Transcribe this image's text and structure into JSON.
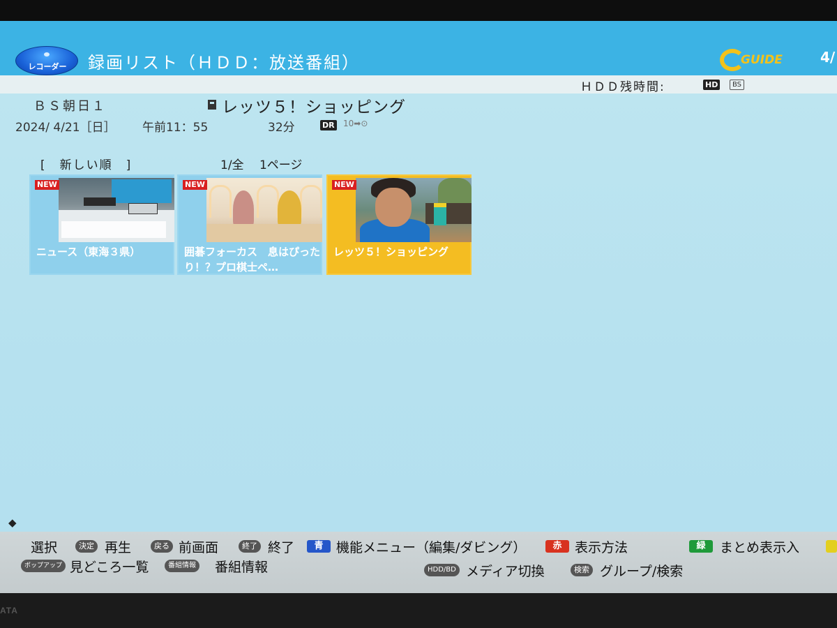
{
  "header": {
    "logo_label": "レコーダー",
    "title": "録画リスト（ＨＤＤ：放送番組）",
    "gguide_label": "GUIDE",
    "page_indicator": "4/"
  },
  "status": {
    "hdd_remaining_label": "ＨＤＤ残時間:",
    "hd_badge": "HD",
    "bs_badge": "BS"
  },
  "selected_program": {
    "channel": "ＢＳ朝日１",
    "title": "レッツ５！ショッピング",
    "date": "2024/ 4/21［日］",
    "time": "午前11：55",
    "duration": "32分",
    "mode_badge": "DR",
    "mode_conversion": "10➡⊙"
  },
  "list": {
    "sort_label": "[　新しい順　]",
    "page_info": "1/全　 1ページ",
    "items": [
      {
        "badge": "NEW",
        "title": "ニュース（東海３県）",
        "selected": false
      },
      {
        "badge": "NEW",
        "title": "囲碁フォーカス　息はぴったり！？プロ棋士ペ…",
        "selected": false
      },
      {
        "badge": "NEW",
        "title": "レッツ５！ショッピング",
        "selected": true
      }
    ]
  },
  "help_bar": {
    "select_label": "選択",
    "decide_key": "決定",
    "play_label": "再生",
    "back_key": "戻る",
    "prev_screen_label": "前画面",
    "end_key": "終了",
    "end_label": "終了",
    "blue_key": "青",
    "function_menu_label": "機能メニュー（編集/ダビング）",
    "red_key": "赤",
    "display_method_label": "表示方法",
    "green_key": "緑",
    "group_display_label": "まとめ表示入",
    "popup_key": "ポップアップ",
    "highlights_label": "見どころ一覧",
    "program_info_key": "番組情報",
    "program_info_label": "番組情報",
    "media_key": "HDD/BD",
    "media_switch_label": "メディア切換",
    "search_key": "検索",
    "group_search_label": "グループ/検索"
  },
  "colors": {
    "header_blue": "#3cb3e4",
    "background": "#bfe6f0",
    "card_blue": "#8fd0ec",
    "card_selected": "#f4bd22",
    "new_badge": "#d92020",
    "key_blue": "#2456c9",
    "key_red": "#d8321f",
    "key_green": "#1f9a3a",
    "key_yellow": "#e3cf1f"
  },
  "bezel": {
    "brand": "ATA"
  }
}
